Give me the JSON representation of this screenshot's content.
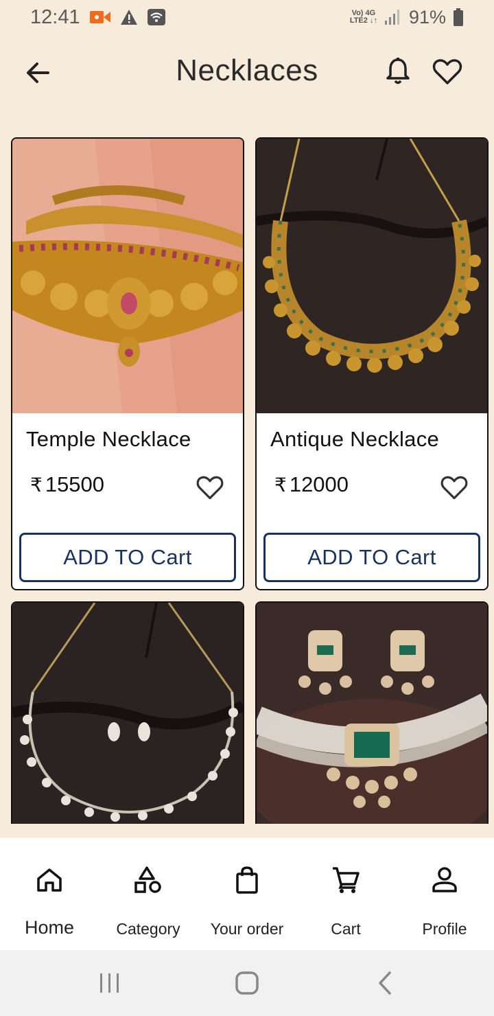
{
  "status_bar": {
    "time": "12:41",
    "network_top": "Vo) 4G",
    "network_bottom": "LTE2 ↓↑",
    "battery": "91%"
  },
  "header": {
    "title": "Necklaces",
    "back_icon": "arrow-left-icon",
    "bell_icon": "bell-icon",
    "favorites_icon": "heart-icon"
  },
  "currency_symbol": "₹",
  "products": [
    {
      "name": "Temple Necklace",
      "price": "15500",
      "button": "ADD TO Cart"
    },
    {
      "name": "Antique Necklace",
      "price": "12000",
      "button": "ADD TO Cart"
    },
    {
      "name": "",
      "price": "",
      "button": ""
    },
    {
      "name": "",
      "price": "",
      "button": ""
    }
  ],
  "bottom_nav": {
    "items": [
      {
        "label": "Home",
        "icon": "home-icon"
      },
      {
        "label": "Category",
        "icon": "category-icon"
      },
      {
        "label": "Your order",
        "icon": "shopping-bag-icon"
      },
      {
        "label": "Cart",
        "icon": "cart-icon"
      },
      {
        "label": "Profile",
        "icon": "profile-icon"
      }
    ]
  },
  "colors": {
    "background": "#f7ebdc",
    "button_border": "#17325e",
    "card_border": "#111111",
    "status_accent": "#f26a1b"
  }
}
